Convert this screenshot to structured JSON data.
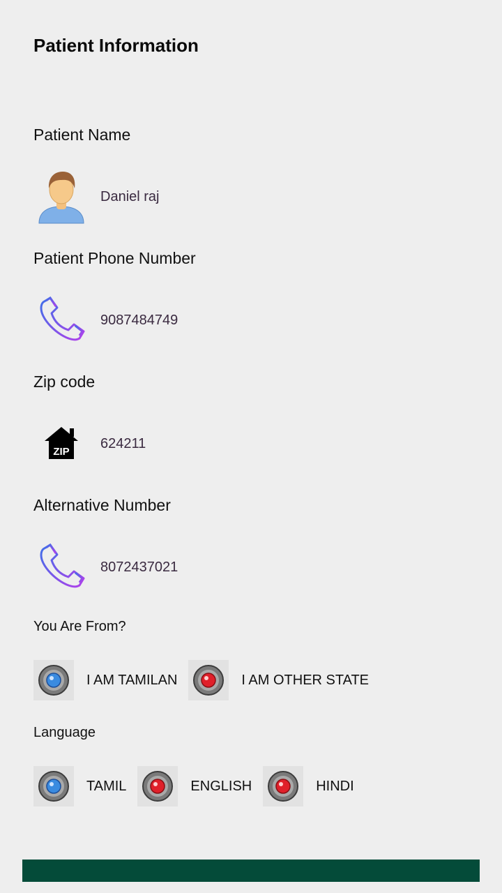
{
  "header": {
    "title": "Patient Information"
  },
  "patient_name": {
    "label": "Patient Name",
    "value": "Daniel raj",
    "icon": "avatar-icon"
  },
  "phone": {
    "label": "Patient Phone Number",
    "value": "9087484749",
    "icon": "phone-icon"
  },
  "zip": {
    "label": "Zip code",
    "value": "624211",
    "icon": "zip-home-icon",
    "badge": "ZIP"
  },
  "alternative": {
    "label": "Alternative Number",
    "value": "8072437021",
    "icon": "phone-icon"
  },
  "origin": {
    "label": "You Are From?",
    "options": [
      {
        "label": "I AM TAMILAN",
        "state": "selected",
        "color": "#3a8be0"
      },
      {
        "label": "I AM OTHER STATE",
        "state": "unselected",
        "color": "#e0202a"
      }
    ]
  },
  "language": {
    "label": "Language",
    "options": [
      {
        "label": "TAMIL",
        "state": "selected",
        "color": "#3a8be0"
      },
      {
        "label": "ENGLISH",
        "state": "unselected",
        "color": "#e0202a"
      },
      {
        "label": "HINDI",
        "state": "unselected",
        "color": "#e0202a"
      }
    ]
  },
  "theme": {
    "footer_color": "#044b39",
    "background": "#eeeeee"
  }
}
